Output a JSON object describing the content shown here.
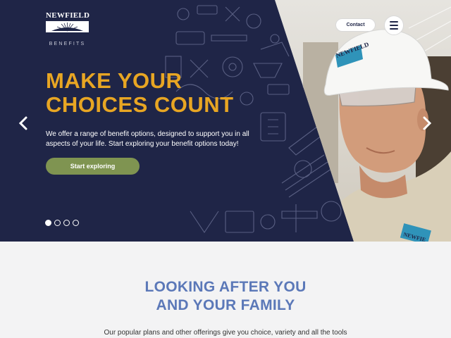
{
  "brand": {
    "name": "NEWFIELD",
    "subtitle": "BENEFITS"
  },
  "header": {
    "contact_label": "Contact"
  },
  "hero": {
    "headline_line1": "MAKE YOUR",
    "headline_line2": "CHOICES COUNT",
    "intro_line1": "We offer a range of benefit options, designed to support you in all",
    "intro_line2": "aspects of your life. Start exploring your benefit options today!",
    "cta_label": "Start exploring",
    "slide_count": 4,
    "active_slide": 1,
    "helmet_text": "NEWFIELD",
    "shirt_text": "NEWFIE"
  },
  "section": {
    "title_line1": "LOOKING AFTER YOU",
    "title_line2": "AND YOUR FAMILY",
    "text": "Our popular plans and other offerings give you choice, variety and all the tools"
  },
  "colors": {
    "hero_bg": "#1f2547",
    "headline": "#e8a623",
    "cta_bg": "#7f9451",
    "section_title": "#5b78b8",
    "page_bg": "#f3f3f4"
  }
}
